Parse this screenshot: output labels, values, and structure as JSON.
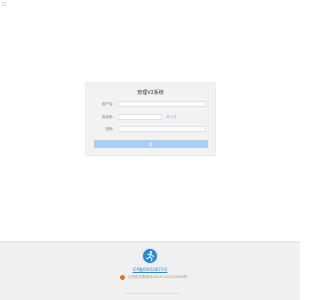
{
  "corner_mark": "□",
  "login": {
    "title": "管理V2系统",
    "fields": [
      {
        "label": "用户名：",
        "value": ""
      },
      {
        "label": "验证码：",
        "value": "",
        "aside": "看不清"
      },
      {
        "label": "密码：",
        "value": ""
      }
    ],
    "submit_label": "登"
  },
  "footer": {
    "logo_icon": "runner-logo-icon",
    "link_text": "ICP备09010875号",
    "police_text": "公安机关备案号44030402001898号"
  },
  "colors": {
    "button_bg": "#a9cdf4",
    "link": "#2e86d8",
    "card_bg": "#f2f2f2",
    "footer_bg": "#f0f0f0"
  }
}
